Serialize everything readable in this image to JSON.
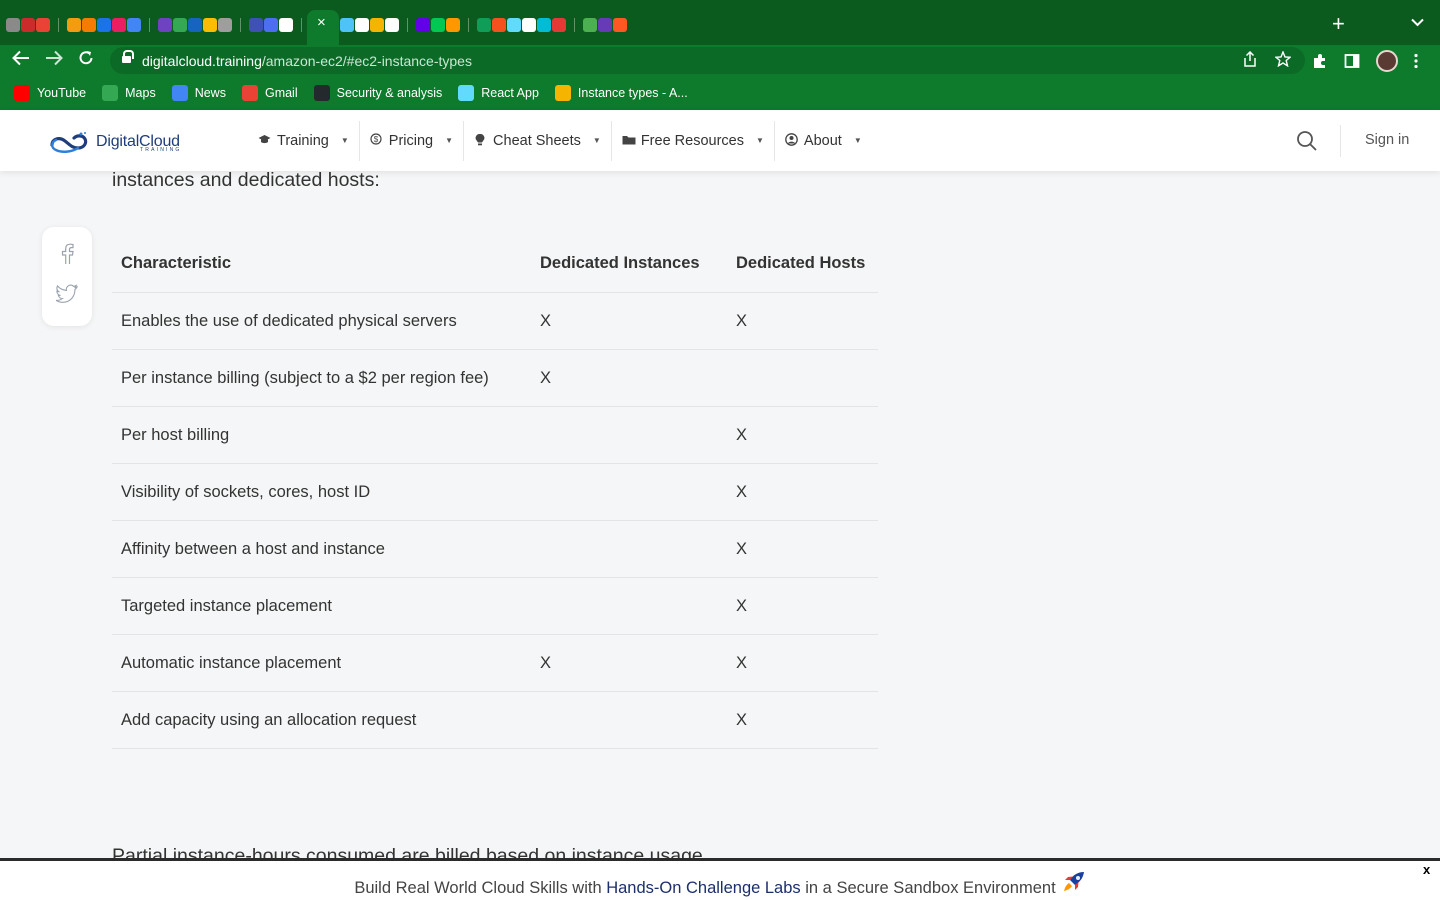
{
  "browser": {
    "url_domain": "digitalcloud.training",
    "url_path": "/amazon-ec2/#ec2-instance-types",
    "active_tab_close": "×",
    "new_tab": "+",
    "tab_menu": "⌄",
    "tab_favicon_colors": [
      "#8a8a8a",
      "#cc2b2b",
      "#ea4335",
      "#f39c12",
      "#f57c00",
      "#1a73e8",
      "#e91e63",
      "#4285f4",
      "#6f42c1",
      "#34a853",
      "#1565c0",
      "#fbbc04",
      "#9e9e9e",
      "#3f51b5",
      "#4e6ef2",
      "#ffffff",
      "#7b1fa2",
      "#f4b400",
      "#4fc3f7",
      "#ffffff",
      "#f4b400",
      "#ffffff",
      "#6200ea",
      "#00c853",
      "#ff9800",
      "#0f9d58",
      "#f4511e",
      "#61dafb",
      "#ffffff",
      "#00bcd4",
      "#e53935",
      "#4caf50",
      "#673ab7",
      "#ff5722"
    ],
    "bookmarks": [
      {
        "label": "YouTube",
        "color": "#ff0000"
      },
      {
        "label": "Maps",
        "color": "#34a853"
      },
      {
        "label": "News",
        "color": "#4285f4"
      },
      {
        "label": "Gmail",
        "color": "#ea4335"
      },
      {
        "label": "Security & analysis",
        "color": "#24292e"
      },
      {
        "label": "React App",
        "color": "#61dafb"
      },
      {
        "label": "Instance types - A...",
        "color": "#f4b400"
      }
    ]
  },
  "site": {
    "logo_text": "DigitalCloud",
    "logo_sub": "TRAINING",
    "nav": [
      {
        "label": "Training",
        "icon": "graduation-cap-icon"
      },
      {
        "label": "Pricing",
        "icon": "dollar-circle-icon"
      },
      {
        "label": "Cheat Sheets",
        "icon": "lightbulb-icon"
      },
      {
        "label": "Free Resources",
        "icon": "folder-icon"
      },
      {
        "label": "About",
        "icon": "user-circle-icon"
      }
    ],
    "sign_in": "Sign in"
  },
  "article": {
    "intro": "instances and dedicated hosts:",
    "table": {
      "headers": [
        "Characteristic",
        "Dedicated Instances",
        "Dedicated Hosts"
      ],
      "rows": [
        [
          "Enables the use of dedicated physical servers",
          "X",
          "X"
        ],
        [
          "Per instance billing (subject to a $2 per region fee)",
          "X",
          ""
        ],
        [
          "Per host billing",
          "",
          "X"
        ],
        [
          "Visibility of sockets, cores, host ID",
          "",
          "X"
        ],
        [
          "Affinity between a host and instance",
          "",
          "X"
        ],
        [
          "Targeted instance placement",
          "",
          "X"
        ],
        [
          "Automatic instance placement",
          "X",
          "X"
        ],
        [
          "Add capacity using an allocation request",
          "",
          "X"
        ]
      ]
    },
    "after_table": "Partial instance-hours consumed are billed based on instance usage"
  },
  "banner": {
    "prefix": "Build Real World Cloud Skills with ",
    "highlight": "Hands-On Challenge Labs",
    "suffix": " in a Secure Sandbox Environment",
    "close": "x"
  }
}
